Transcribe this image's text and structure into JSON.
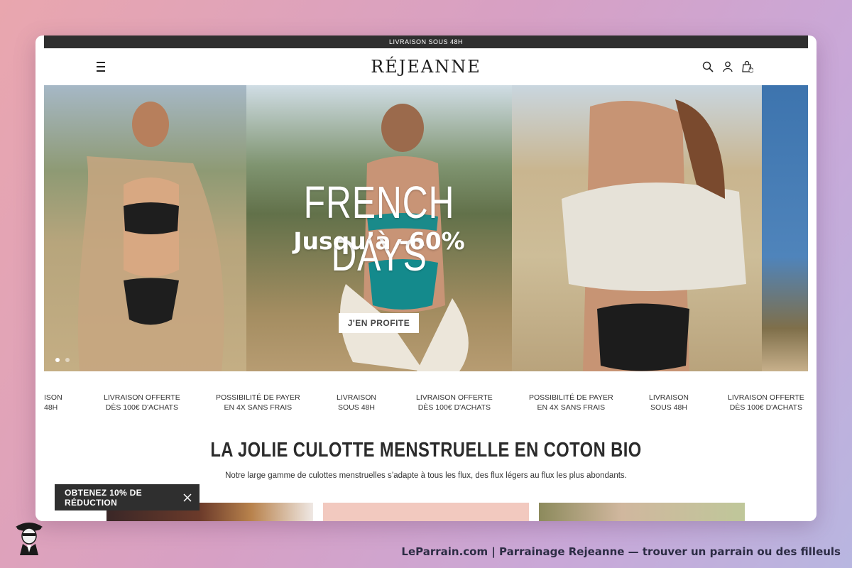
{
  "announcement": "LIVRAISON SOUS 48H",
  "header": {
    "logo": "RÉJEANNE",
    "cart_count": "0"
  },
  "hero": {
    "title": "FRENCH DAYS",
    "subtitle": "Jusqu’à -60%",
    "cta": "J'EN PROFITE",
    "slide_count": 2,
    "active_slide": 1
  },
  "benefits": [
    {
      "line1": "ISON",
      "line2": "48H"
    },
    {
      "line1": "LIVRAISON OFFERTE",
      "line2": "DÈS 100€ D'ACHATS"
    },
    {
      "line1": "POSSIBILITÉ DE PAYER",
      "line2": "EN 4X SANS FRAIS"
    },
    {
      "line1": "LIVRAISON",
      "line2": "SOUS 48H"
    },
    {
      "line1": "LIVRAISON OFFERTE",
      "line2": "DÈS 100€ D'ACHATS"
    },
    {
      "line1": "POSSIBILITÉ DE PAYER",
      "line2": "EN 4X SANS FRAIS"
    },
    {
      "line1": "LIVRAISON",
      "line2": "SOUS 48H"
    },
    {
      "line1": "LIVRAISON OFFERTE",
      "line2": "DÈS 100€ D'ACHATS"
    }
  ],
  "section": {
    "title": "LA JOLIE CULOTTE MENSTRUELLE EN COTON BIO",
    "description": "Notre large gamme de culottes menstruelles s’adapte à tous les flux, des flux légers au flux les plus abondants."
  },
  "promo": {
    "label": "OBTENEZ 10% DE RÉDUCTION"
  },
  "footer": {
    "caption": "LeParrain.com | Parrainage Rejeanne — trouver un parrain ou des filleuls"
  },
  "colors": {
    "dark_bar": "#2f2f2f",
    "text": "#2b2b2b"
  }
}
